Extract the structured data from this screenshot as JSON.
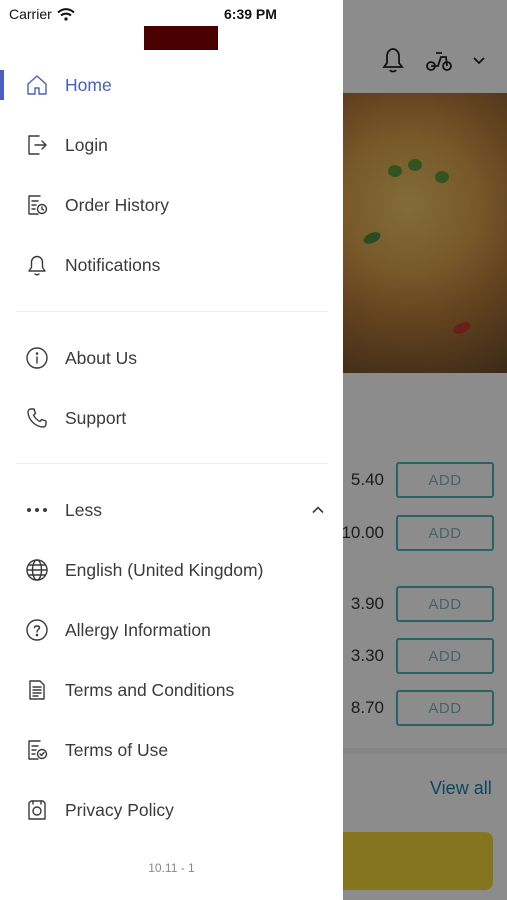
{
  "status_bar": {
    "carrier": "Carrier",
    "time": "6:39 PM"
  },
  "drawer": {
    "items": [
      {
        "label": "Home",
        "icon": "home-icon",
        "active": true
      },
      {
        "label": "Login",
        "icon": "login-icon"
      },
      {
        "label": "Order History",
        "icon": "order-history-icon"
      },
      {
        "label": "Notifications",
        "icon": "bell-icon"
      },
      {
        "label": "About Us",
        "icon": "info-icon"
      },
      {
        "label": "Support",
        "icon": "phone-icon"
      },
      {
        "label": "Less",
        "icon": "more-dots-icon"
      },
      {
        "label": "English (United Kingdom)",
        "icon": "globe-icon"
      },
      {
        "label": "Allergy Information",
        "icon": "question-icon"
      },
      {
        "label": "Terms and Conditions",
        "icon": "document-icon"
      },
      {
        "label": "Terms of Use",
        "icon": "document-check-icon"
      },
      {
        "label": "Privacy Policy",
        "icon": "privacy-icon"
      }
    ],
    "version": "10.11 - 1"
  },
  "background": {
    "items": [
      {
        "price": "5.40",
        "add_label": "ADD"
      },
      {
        "price": "10.00",
        "add_label": "ADD"
      },
      {
        "price": "3.90",
        "add_label": "ADD"
      },
      {
        "price": "3.30",
        "add_label": "ADD"
      },
      {
        "price": "8.70",
        "add_label": "ADD"
      }
    ],
    "view_all": "View all"
  },
  "colors": {
    "accent": "#4a5fc1",
    "add_border": "#4fb5b5",
    "cta": "#f3d63a",
    "view_all": "#1b7fa8"
  }
}
